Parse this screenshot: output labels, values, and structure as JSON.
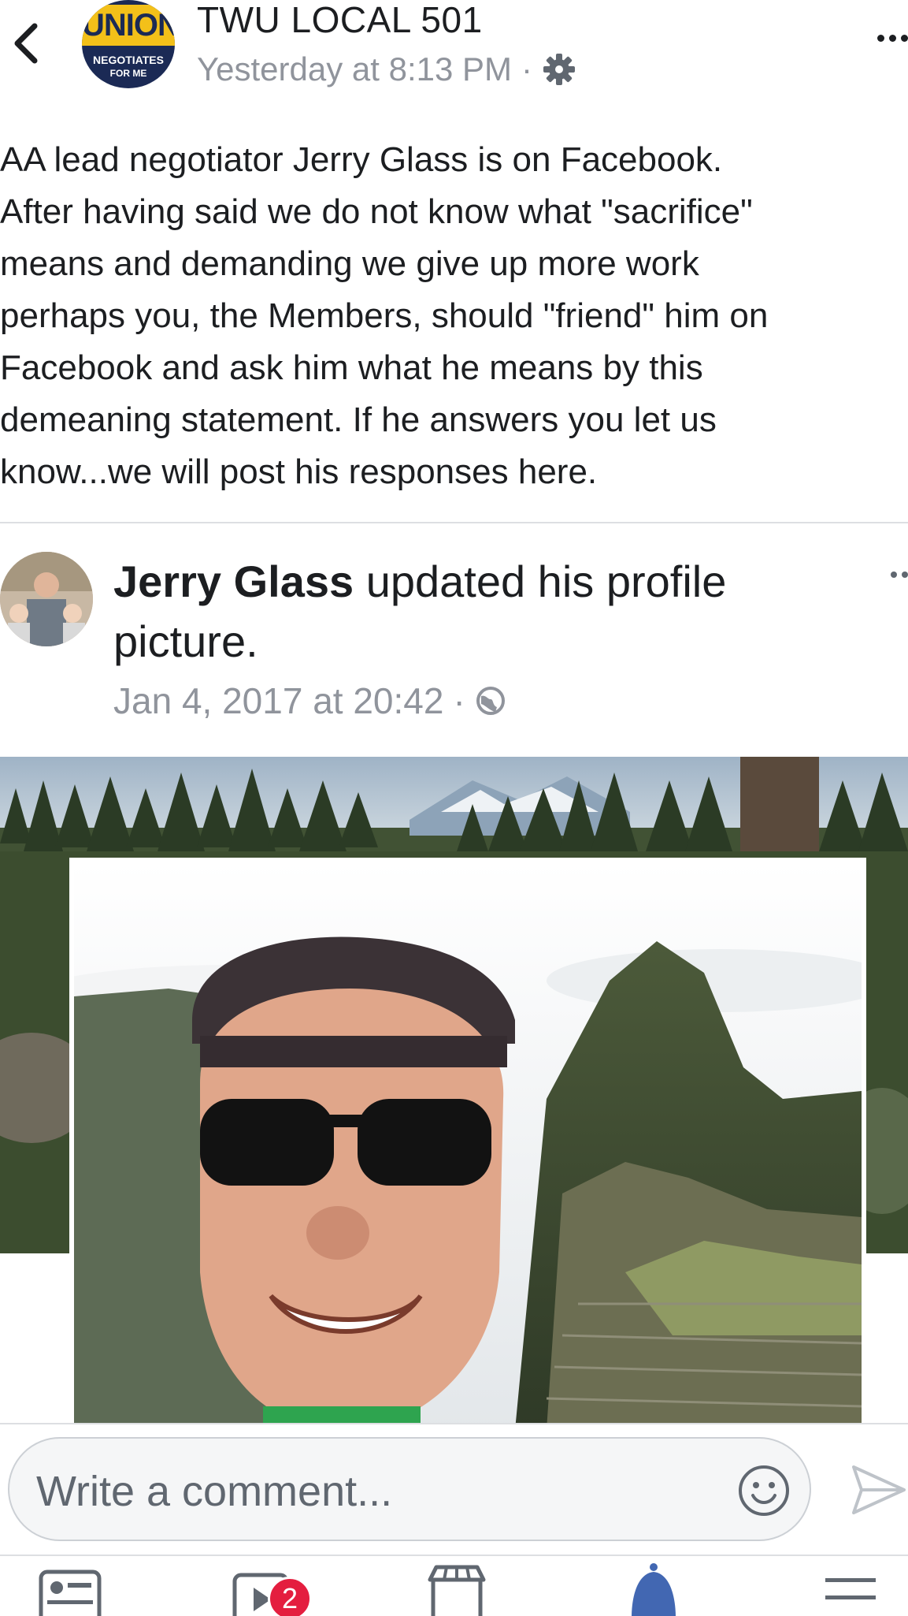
{
  "header": {
    "page_name": "TWU LOCAL 501",
    "timestamp": "Yesterday at 8:13 PM",
    "separator": "·",
    "privacy_icon": "gear-icon",
    "logo": {
      "top_text": "UNION",
      "mid_text": "NEGOTIATES",
      "bottom_text": "FOR ME"
    }
  },
  "post": {
    "body": "AA lead negotiator Jerry Glass is on Facebook.\nAfter having said we do not know what \"sacrifice\"\nmeans and demanding we give up more work\nperhaps you, the Members, should \"friend\" him on\nFacebook and ask him what he means by this\ndemeaning statement.  If he answers you let us\nknow...we will post his responses here."
  },
  "shared_post": {
    "author": "Jerry Glass",
    "action_line1": " updated his profile",
    "action_line2": "picture.",
    "timestamp": "Jan 4, 2017 at 20:42",
    "separator": "·",
    "privacy_icon": "globe-icon"
  },
  "comment_bar": {
    "placeholder": "Write a comment..."
  },
  "bottom_nav": {
    "items": [
      "news-feed-icon",
      "watch-icon",
      "marketplace-icon",
      "notifications-icon",
      "menu-icon"
    ],
    "watch_badge": "2",
    "active_color": "#4267b2"
  },
  "colors": {
    "text": "#1c1e21",
    "secondary": "#90949c",
    "badge": "#e41e3f",
    "logo_yellow": "#f3c019",
    "logo_navy": "#1b2a55"
  }
}
